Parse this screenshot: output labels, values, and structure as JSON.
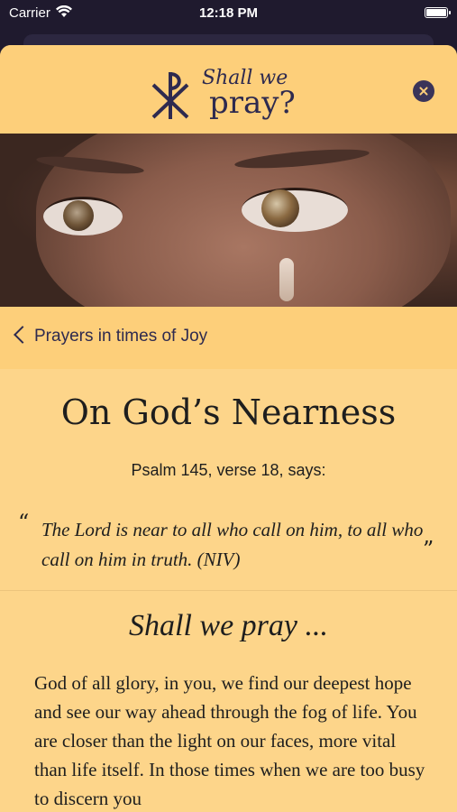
{
  "status_bar": {
    "carrier": "Carrier",
    "time": "12:18 PM"
  },
  "header": {
    "logo_line1": "Shall we",
    "logo_line2": "pray?"
  },
  "nav": {
    "back_label": "Prayers in times of Joy"
  },
  "content": {
    "title": "On God’s Nearness",
    "reference": "Psalm 145, verse 18, says:",
    "quote_open": "“",
    "quote_close": "”",
    "quote": "The Lord is near to all who call on him,    to all who call on him in truth. (NIV)",
    "subtitle": "Shall we pray ...",
    "prayer": "God of all glory, in you, we find our deepest hope and see our way ahead through the fog of life. You are closer than the light on our faces, more vital than life itself. In those times when we are too busy to discern you"
  },
  "colors": {
    "header_bg": "#fdcf7a",
    "sheet_bg": "#fdd58a",
    "brand_ink": "#2e2a4f",
    "text": "#1e1e1e"
  }
}
